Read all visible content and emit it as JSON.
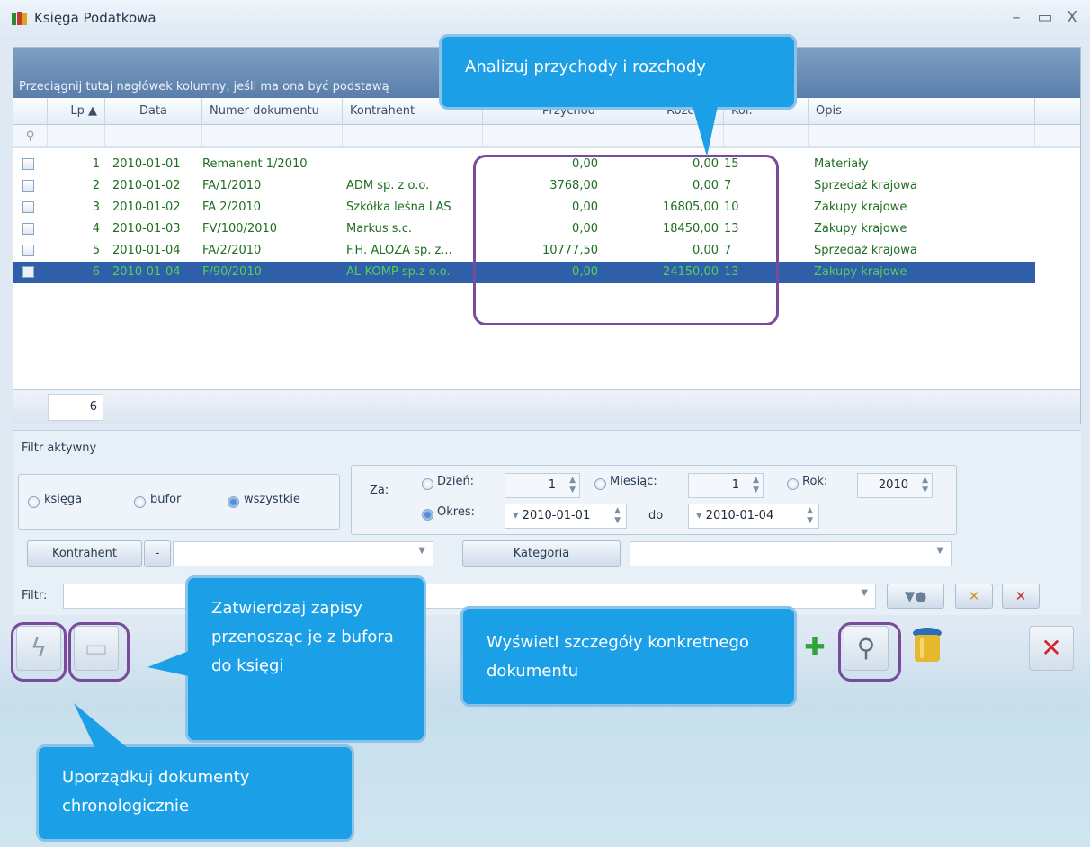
{
  "window": {
    "title": "Księga Podatkowa",
    "min_symbol": "–",
    "max_symbol": "▭",
    "close_symbol": "X"
  },
  "grid": {
    "group_hint": "Przeciągnij tutaj nagłówek kolumny, jeśli ma ona być podstawą",
    "columns": [
      "Lp ▲",
      "Data",
      "Numer dokumentu",
      "Kontrahent",
      "Przychód",
      "Rozchód",
      "Kol.",
      "Opis"
    ],
    "rows": [
      {
        "lp": "1",
        "data": "2010-01-01",
        "numer": "Remanent 1/2010",
        "kontrahent": "",
        "przychod": "0,00",
        "rozchod": "0,00",
        "kol": "15",
        "opis": "Materiały"
      },
      {
        "lp": "2",
        "data": "2010-01-02",
        "numer": "FA/1/2010",
        "kontrahent": "ADM sp. z o.o.",
        "przychod": "3768,00",
        "rozchod": "0,00",
        "kol": "7",
        "opis": "Sprzedaż krajowa"
      },
      {
        "lp": "3",
        "data": "2010-01-02",
        "numer": "FA 2/2010",
        "kontrahent": "Szkółka leśna LAS",
        "przychod": "0,00",
        "rozchod": "16805,00",
        "kol": "10",
        "opis": "Zakupy krajowe"
      },
      {
        "lp": "4",
        "data": "2010-01-03",
        "numer": "FV/100/2010",
        "kontrahent": "Markus s.c.",
        "przychod": "0,00",
        "rozchod": "18450,00",
        "kol": "13",
        "opis": "Zakupy krajowe"
      },
      {
        "lp": "5",
        "data": "2010-01-04",
        "numer": "FA/2/2010",
        "kontrahent": "F.H. ALOZA sp. z...",
        "przychod": "10777,50",
        "rozchod": "0,00",
        "kol": "7",
        "opis": "Sprzedaż krajowa"
      },
      {
        "lp": "6",
        "data": "2010-01-04",
        "numer": "F/90/2010",
        "kontrahent": "AL-KOMP sp.z o.o.",
        "przychod": "0,00",
        "rozchod": "24150,00",
        "kol": "13",
        "opis": "Zakupy krajowe"
      }
    ],
    "count": "6"
  },
  "filter": {
    "active_label": "Filtr aktywny",
    "scope_options": [
      "księga",
      "bufor",
      "wszystkie"
    ],
    "za_label": "Za:",
    "dzien_label": "Dzień:",
    "dzien_value": "1",
    "miesiac_label": "Miesiąc:",
    "miesiac_value": "1",
    "rok_label": "Rok:",
    "rok_value": "2010",
    "okres_label": "Okres:",
    "okres_from": "2010-01-01",
    "do_label": "do",
    "okres_to": "2010-01-04",
    "kontrahent_button": "Kontrahent",
    "kategoria_button": "Kategoria",
    "filtr_label": "Filtr:"
  },
  "callouts": {
    "analyze": "Analizuj przychody i rozchody",
    "approve": "Zatwierdzaj zapisy przenosząc je z bufora do księgi",
    "details": "Wyświetl szczegóły konkretnego dokumentu",
    "order": "Uporządkuj dokumenty chronologicznie"
  },
  "colors": {
    "callout_blue": "#1b9fe6",
    "highlight_purple": "#7a4a9c",
    "selected_row": "#2f5fa8",
    "row_text_green": "#1f6e1f"
  },
  "icons": [
    "app-icon",
    "sort-asc-icon",
    "filter-icon",
    "lightning-icon",
    "book-icon",
    "plus-icon",
    "magnifier-icon",
    "trash-icon",
    "close-icon"
  ]
}
